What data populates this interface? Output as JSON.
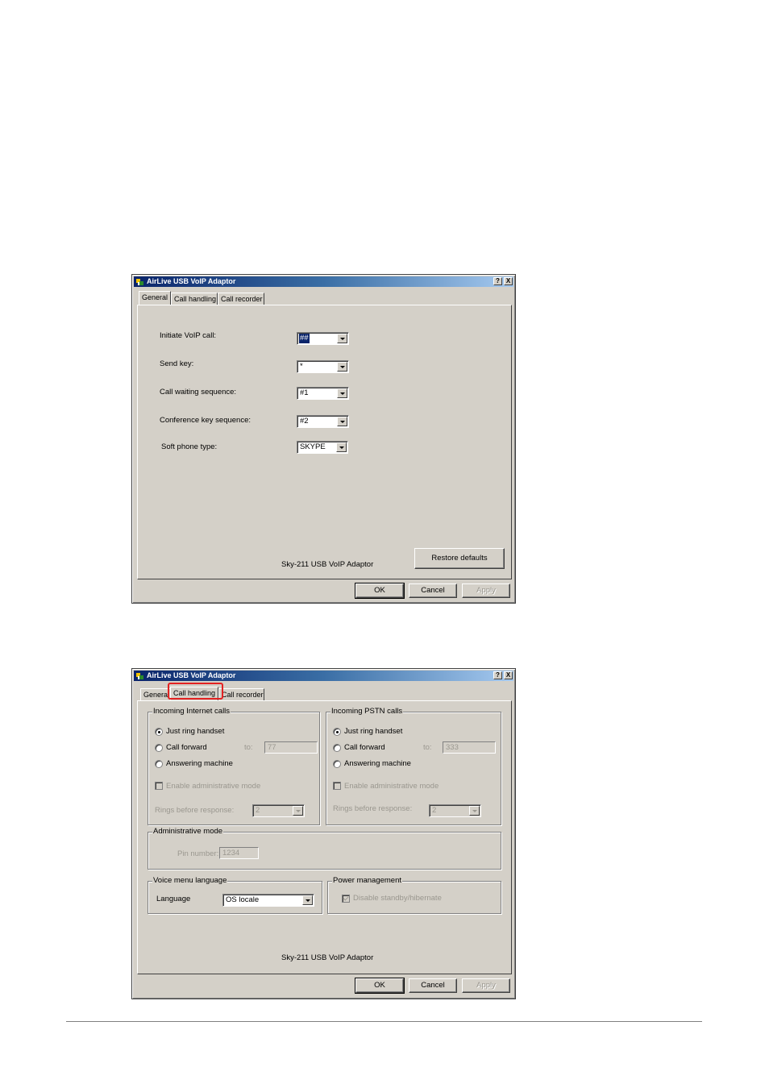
{
  "colors": {
    "face": "#d4d0c8",
    "titlebar": "#0a246a",
    "highlight": "#e32222"
  },
  "window1": {
    "title": "AirLive USB VoIP Adaptor",
    "help_btn": "?",
    "close_btn": "X",
    "tabs": [
      "General",
      "Call handling",
      "Call recorder"
    ],
    "active_tab": "General",
    "fields": [
      {
        "label": "Initiate VoIP call:",
        "value": "##"
      },
      {
        "label": "Send key:",
        "value": "*"
      },
      {
        "label": "Call waiting sequence:",
        "value": "#1"
      },
      {
        "label": "Conference key sequence:",
        "value": "#2"
      },
      {
        "label": "Soft phone type:",
        "value": "SKYPE"
      }
    ],
    "restore_defaults": "Restore defaults",
    "product_label": "Sky-211 USB VoIP Adaptor",
    "ok": "OK",
    "cancel": "Cancel",
    "apply": "Apply"
  },
  "window2": {
    "title": "AirLive USB VoIP Adaptor",
    "help_btn": "?",
    "close_btn": "X",
    "tabs": [
      "General",
      "Call handling",
      "Call recorder"
    ],
    "active_tab": "Call handling",
    "internet": {
      "title": "Incoming Internet calls",
      "options": [
        "Just ring handset",
        "Call forward",
        "Answering machine"
      ],
      "selected": "Just ring handset",
      "to_label": "to:",
      "forward_number": "77",
      "enable_admin": "Enable administrative mode",
      "rings_label": "Rings before response:",
      "rings_value": "2"
    },
    "pstn": {
      "title": "Incoming PSTN calls",
      "options": [
        "Just ring handset",
        "Call forward",
        "Answering machine"
      ],
      "selected": "Just ring handset",
      "to_label": "to:",
      "forward_number": "333",
      "enable_admin": "Enable administrative mode",
      "rings_label": "Rings before response:",
      "rings_value": "2"
    },
    "admin": {
      "title": "Administrative mode",
      "pin_label": "Pin number:",
      "pin_value": "1234"
    },
    "voice_menu": {
      "title": "Voice menu language",
      "language_label": "Language",
      "language_value": "OS locale"
    },
    "power": {
      "title": "Power management",
      "disable_standby": "Disable standby/hibernate",
      "disable_standby_checked": true
    },
    "product_label": "Sky-211 USB VoIP Adaptor",
    "ok": "OK",
    "cancel": "Cancel",
    "apply": "Apply"
  }
}
